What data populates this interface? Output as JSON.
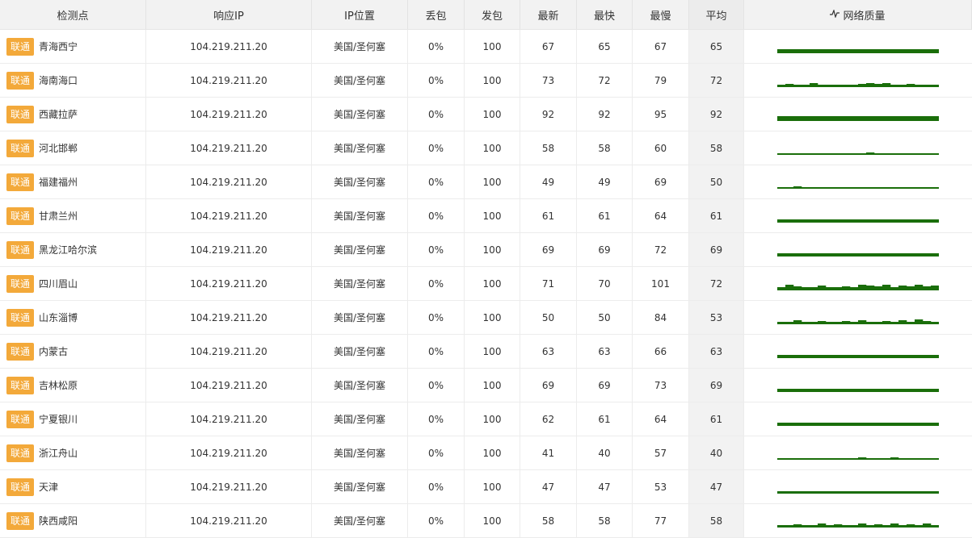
{
  "headers": {
    "location": "检测点",
    "ip": "响应IP",
    "ip_location": "IP位置",
    "loss": "丢包",
    "sent": "发包",
    "latest": "最新",
    "fastest": "最快",
    "slowest": "最慢",
    "average": "平均",
    "quality": "网络质量",
    "quality_icon": "pulse-icon"
  },
  "colors": {
    "isp_badge": "#f3a93a",
    "sparkline": "#1a6e0a"
  },
  "rows": [
    {
      "isp": "联通",
      "location": "青海西宁",
      "ip": "104.219.211.20",
      "ip_location": "美国/圣何塞",
      "loss": "0%",
      "sent": "100",
      "latest": "67",
      "fastest": "65",
      "slowest": "67",
      "average": "65",
      "quality": [
        3,
        3,
        3,
        3,
        3,
        3,
        3,
        3,
        3,
        3,
        3,
        3,
        3,
        3,
        3,
        3,
        3,
        3,
        3,
        3
      ]
    },
    {
      "isp": "联通",
      "location": "海南海口",
      "ip": "104.219.211.20",
      "ip_location": "美国/圣何塞",
      "loss": "0%",
      "sent": "100",
      "latest": "73",
      "fastest": "72",
      "slowest": "79",
      "average": "72",
      "quality": [
        1,
        2,
        1,
        1,
        3,
        1,
        1,
        1,
        1,
        1,
        2,
        3,
        2,
        3,
        1,
        1,
        2,
        1,
        1,
        1
      ]
    },
    {
      "isp": "联通",
      "location": "西藏拉萨",
      "ip": "104.219.211.20",
      "ip_location": "美国/圣何塞",
      "loss": "0%",
      "sent": "100",
      "latest": "92",
      "fastest": "92",
      "slowest": "95",
      "average": "92",
      "quality": [
        4,
        4,
        4,
        4,
        4,
        4,
        4,
        4,
        4,
        4,
        4,
        4,
        4,
        4,
        4,
        4,
        4,
        4,
        4,
        4
      ]
    },
    {
      "isp": "联通",
      "location": "河北邯郸",
      "ip": "104.219.211.20",
      "ip_location": "美国/圣何塞",
      "loss": "0%",
      "sent": "100",
      "latest": "58",
      "fastest": "58",
      "slowest": "60",
      "average": "58",
      "quality": [
        0,
        0,
        0,
        0,
        0,
        0,
        0,
        0,
        0,
        0,
        0,
        1,
        0,
        0,
        0,
        0,
        0,
        0,
        0,
        0
      ]
    },
    {
      "isp": "联通",
      "location": "福建福州",
      "ip": "104.219.211.20",
      "ip_location": "美国/圣何塞",
      "loss": "0%",
      "sent": "100",
      "latest": "49",
      "fastest": "49",
      "slowest": "69",
      "average": "50",
      "quality": [
        0,
        0,
        1,
        0,
        0,
        0,
        0,
        0,
        0,
        0,
        0,
        0,
        0,
        0,
        0,
        0,
        0,
        0,
        0,
        0
      ]
    },
    {
      "isp": "联通",
      "location": "甘肃兰州",
      "ip": "104.219.211.20",
      "ip_location": "美国/圣何塞",
      "loss": "0%",
      "sent": "100",
      "latest": "61",
      "fastest": "61",
      "slowest": "64",
      "average": "61",
      "quality": [
        2,
        2,
        2,
        2,
        2,
        2,
        2,
        2,
        2,
        2,
        2,
        2,
        2,
        2,
        2,
        2,
        2,
        2,
        2,
        2
      ]
    },
    {
      "isp": "联通",
      "location": "黑龙江哈尔滨",
      "ip": "104.219.211.20",
      "ip_location": "美国/圣何塞",
      "loss": "0%",
      "sent": "100",
      "latest": "69",
      "fastest": "69",
      "slowest": "72",
      "average": "69",
      "quality": [
        2,
        2,
        2,
        2,
        2,
        2,
        2,
        2,
        2,
        2,
        2,
        2,
        2,
        2,
        2,
        2,
        2,
        2,
        2,
        2
      ]
    },
    {
      "isp": "联通",
      "location": "四川眉山",
      "ip": "104.219.211.20",
      "ip_location": "美国/圣何塞",
      "loss": "0%",
      "sent": "100",
      "latest": "71",
      "fastest": "70",
      "slowest": "101",
      "average": "72",
      "quality": [
        2,
        5,
        3,
        2,
        2,
        4,
        2,
        2,
        3,
        2,
        5,
        4,
        3,
        5,
        2,
        4,
        3,
        5,
        3,
        4
      ]
    },
    {
      "isp": "联通",
      "location": "山东淄博",
      "ip": "104.219.211.20",
      "ip_location": "美国/圣何塞",
      "loss": "0%",
      "sent": "100",
      "latest": "50",
      "fastest": "50",
      "slowest": "84",
      "average": "53",
      "quality": [
        1,
        1,
        3,
        1,
        1,
        2,
        1,
        1,
        2,
        1,
        3,
        1,
        1,
        2,
        1,
        3,
        1,
        4,
        2,
        1
      ]
    },
    {
      "isp": "联通",
      "location": "内蒙古",
      "ip": "104.219.211.20",
      "ip_location": "美国/圣何塞",
      "loss": "0%",
      "sent": "100",
      "latest": "63",
      "fastest": "63",
      "slowest": "66",
      "average": "63",
      "quality": [
        2,
        2,
        2,
        2,
        2,
        2,
        2,
        2,
        2,
        2,
        2,
        2,
        2,
        2,
        2,
        2,
        2,
        2,
        2,
        2
      ]
    },
    {
      "isp": "联通",
      "location": "吉林松原",
      "ip": "104.219.211.20",
      "ip_location": "美国/圣何塞",
      "loss": "0%",
      "sent": "100",
      "latest": "69",
      "fastest": "69",
      "slowest": "73",
      "average": "69",
      "quality": [
        2,
        2,
        2,
        2,
        2,
        2,
        2,
        2,
        2,
        2,
        2,
        2,
        2,
        2,
        2,
        2,
        2,
        2,
        2,
        2
      ]
    },
    {
      "isp": "联通",
      "location": "宁夏银川",
      "ip": "104.219.211.20",
      "ip_location": "美国/圣何塞",
      "loss": "0%",
      "sent": "100",
      "latest": "62",
      "fastest": "61",
      "slowest": "64",
      "average": "61",
      "quality": [
        2,
        2,
        2,
        2,
        2,
        2,
        2,
        2,
        2,
        2,
        2,
        2,
        2,
        2,
        2,
        2,
        2,
        2,
        2,
        2
      ]
    },
    {
      "isp": "联通",
      "location": "浙江舟山",
      "ip": "104.219.211.20",
      "ip_location": "美国/圣何塞",
      "loss": "0%",
      "sent": "100",
      "latest": "41",
      "fastest": "40",
      "slowest": "57",
      "average": "40",
      "quality": [
        0,
        0,
        0,
        0,
        0,
        0,
        0,
        0,
        0,
        0,
        1,
        0,
        0,
        0,
        1,
        0,
        0,
        0,
        0,
        0
      ]
    },
    {
      "isp": "联通",
      "location": "天津",
      "ip": "104.219.211.20",
      "ip_location": "美国/圣何塞",
      "loss": "0%",
      "sent": "100",
      "latest": "47",
      "fastest": "47",
      "slowest": "53",
      "average": "47",
      "quality": [
        1,
        1,
        1,
        1,
        1,
        1,
        1,
        1,
        1,
        1,
        1,
        1,
        1,
        1,
        1,
        1,
        1,
        1,
        1,
        1
      ]
    },
    {
      "isp": "联通",
      "location": "陕西咸阳",
      "ip": "104.219.211.20",
      "ip_location": "美国/圣何塞",
      "loss": "0%",
      "sent": "100",
      "latest": "58",
      "fastest": "58",
      "slowest": "77",
      "average": "58",
      "quality": [
        1,
        1,
        2,
        1,
        1,
        3,
        1,
        2,
        1,
        1,
        3,
        1,
        2,
        1,
        3,
        1,
        2,
        1,
        3,
        1
      ]
    }
  ]
}
